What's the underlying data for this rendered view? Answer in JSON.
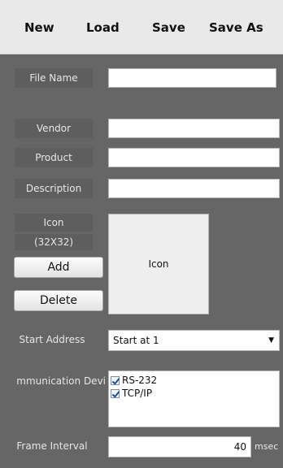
{
  "toolbar": {
    "new": "New",
    "load": "Load",
    "save": "Save",
    "save_as": "Save As"
  },
  "form": {
    "file_name": {
      "label": "File Name",
      "value": ""
    },
    "vendor": {
      "label": "Vendor",
      "value": ""
    },
    "product": {
      "label": "Product",
      "value": ""
    },
    "description": {
      "label": "Description",
      "value": ""
    },
    "icon": {
      "label": "Icon",
      "size_hint": "(32X32)",
      "add_label": "Add",
      "delete_label": "Delete",
      "preview_text": "Icon"
    },
    "start_address": {
      "label": "Start Address",
      "selected": "Start at 1"
    },
    "communication_device": {
      "label": "mmunication Devi",
      "options": [
        {
          "label": "RS-232",
          "checked": true
        },
        {
          "label": "TCP/IP",
          "checked": true
        }
      ]
    },
    "frame_interval": {
      "label": "Frame Interval",
      "value": "40",
      "unit": "msec"
    }
  }
}
